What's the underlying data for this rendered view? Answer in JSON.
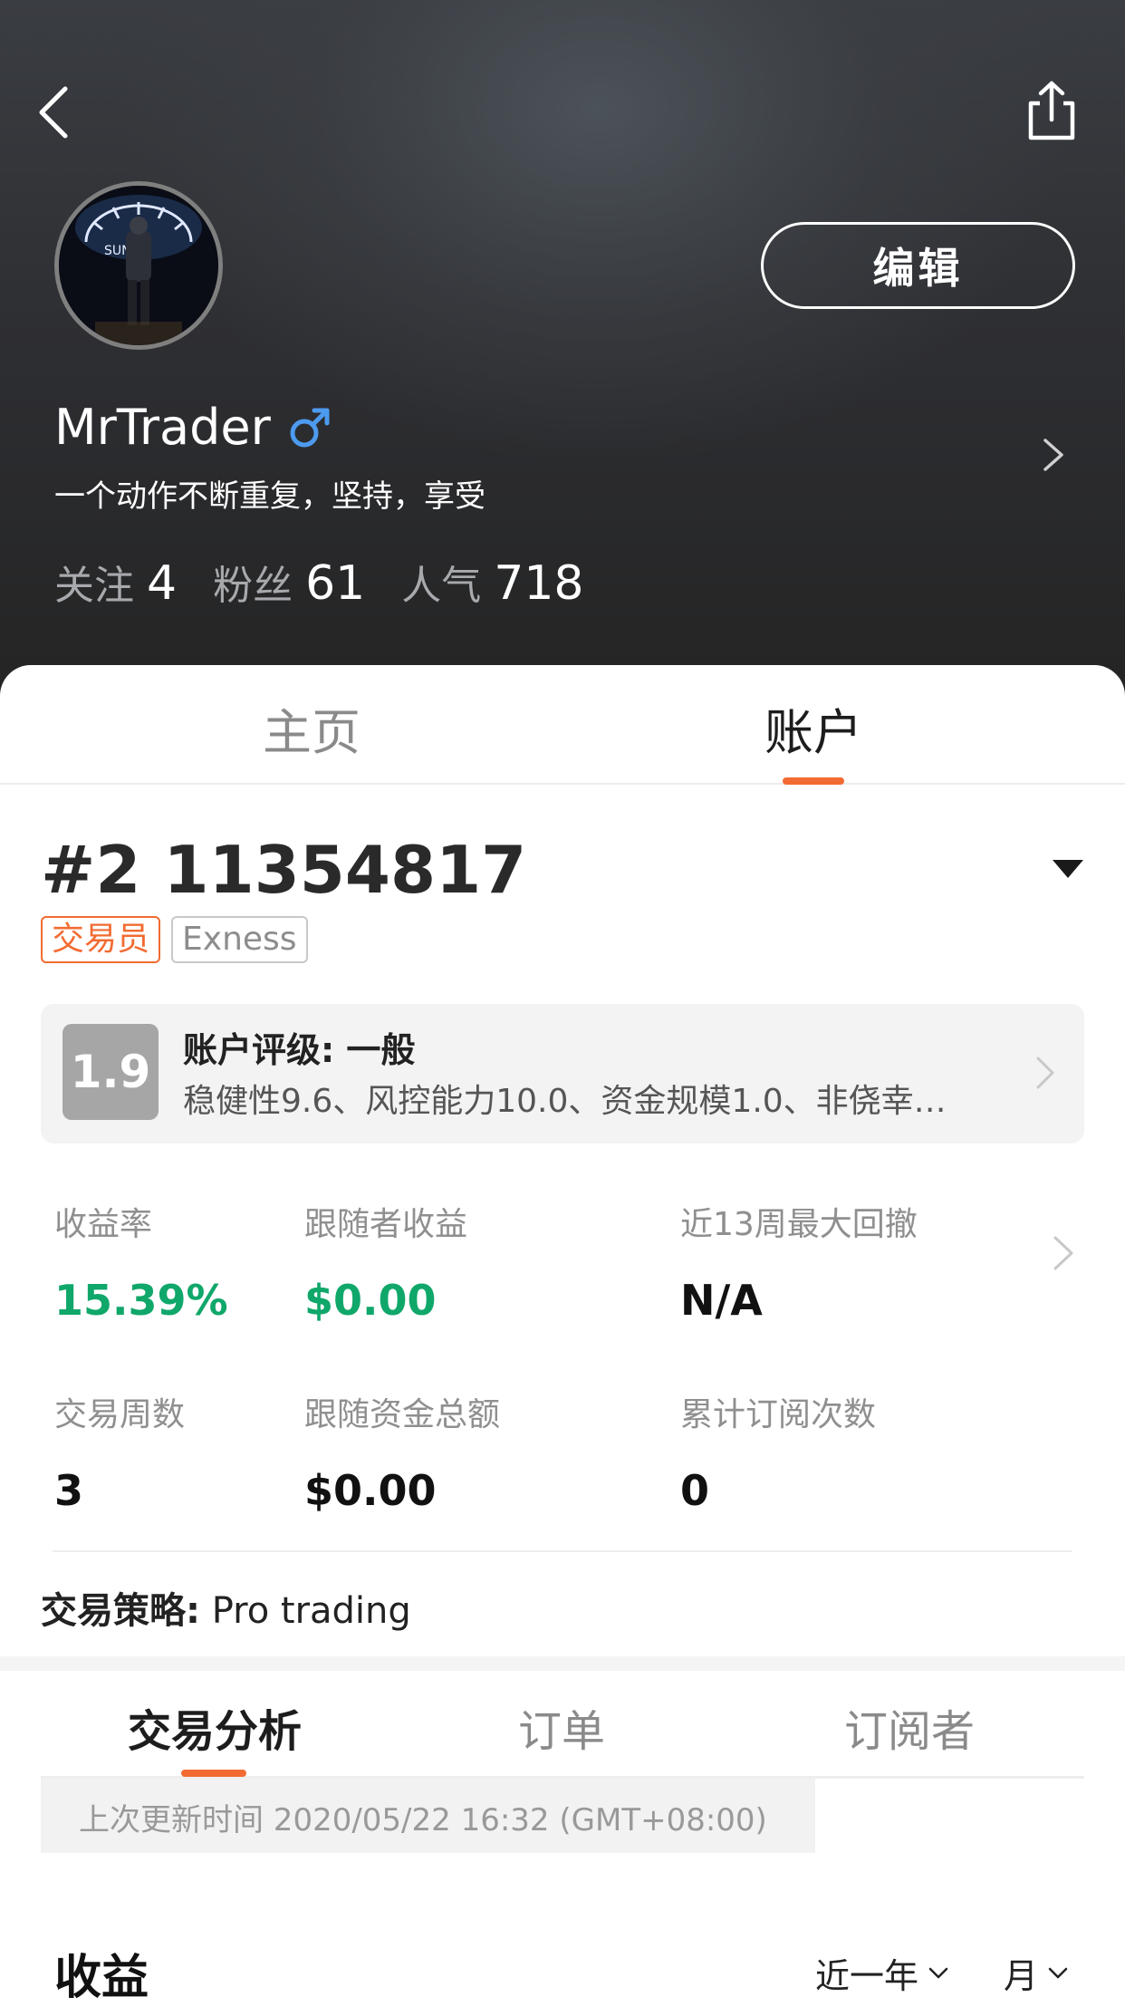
{
  "header": {
    "username": "MrTrader",
    "gender_symbol": "♂",
    "bio": "一个动作不断重复，坚持，享受",
    "edit_label": "编辑",
    "stats": [
      {
        "label": "关注",
        "value": "4"
      },
      {
        "label": "粉丝",
        "value": "61"
      },
      {
        "label": "人气",
        "value": "718"
      }
    ]
  },
  "tabs": [
    {
      "label": "主页",
      "active": false
    },
    {
      "label": "账户",
      "active": true
    }
  ],
  "account": {
    "id": "#2 11354817",
    "tags": [
      "交易员",
      "Exness"
    ],
    "rating": {
      "score": "1.9",
      "title": "账户评级: 一般",
      "desc": "稳健性9.6、风控能力10.0、资金规模1.0、非侥幸…"
    },
    "metrics": [
      {
        "label": "收益率",
        "value": "15.39%"
      },
      {
        "label": "跟随者收益",
        "value": "$0.00"
      },
      {
        "label": "近13周最大回撤",
        "value": "N/A"
      },
      {
        "label": "交易周数",
        "value": "3"
      },
      {
        "label": "跟随资金总额",
        "value": "$0.00"
      },
      {
        "label": "累计订阅次数",
        "value": "0"
      }
    ],
    "strategy_label": "交易策略:",
    "strategy_value": " Pro trading"
  },
  "sub_tabs": [
    {
      "label": "交易分析",
      "active": true
    },
    {
      "label": "订单",
      "active": false
    },
    {
      "label": "订阅者",
      "active": false
    }
  ],
  "update_text": "上次更新时间 2020/05/22 16:32 (GMT+08:00)",
  "section": {
    "title": "收益",
    "period_filter": "近一年",
    "unit_filter": "月"
  },
  "colors": {
    "accent": "#f26b32",
    "positive": "#10a76a",
    "gender": "#4d9bef"
  }
}
